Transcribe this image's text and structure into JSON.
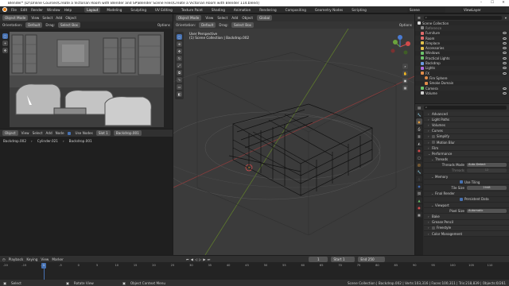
{
  "window": {
    "title": "Blender* [D:\\Online Courses\\Create a Victorian Room with Blender and SP\\Blender Scene Files\\Create a Victorian Room with Blender 114.blend]",
    "controls": [
      "–",
      "☐",
      "✕"
    ]
  },
  "menu": {
    "items": [
      "File",
      "Edit",
      "Render",
      "Window",
      "Help"
    ],
    "workspaces": [
      "Layout",
      "Modeling",
      "Sculpting",
      "UV Editing",
      "Texture Paint",
      "Shading",
      "Animation",
      "Rendering",
      "Compositing",
      "Geometry Nodes",
      "Scripting"
    ],
    "active_workspace": "Layout",
    "scene_label": "Scene",
    "view_layer_label": "ViewLayer"
  },
  "render_view": {
    "mode": "Object Mode",
    "menus": [
      "View",
      "Select",
      "Add",
      "Object"
    ],
    "orientation_label": "Orientation:",
    "orientation_value": "Default",
    "drag_label": "Drag:",
    "drag_value": "Select Box",
    "options_label": "Options"
  },
  "viewport": {
    "mode": "Object Mode",
    "menus": [
      "View",
      "Select",
      "Add",
      "Object"
    ],
    "transform": "Global",
    "orientation_label": "Orientation:",
    "orientation_value": "Default",
    "drag_label": "Drag:",
    "drag_value": "Select Box",
    "options_label": "Options",
    "info_line1": "User Perspective",
    "info_line2": "(1) Scene Collection | Backdrop.002",
    "gizmo_labels": [
      "X",
      "Y",
      "Z"
    ]
  },
  "node_editor": {
    "editor": "Object",
    "menus": [
      "View",
      "Select",
      "Add",
      "Node"
    ],
    "use_nodes_label": "Use Nodes",
    "slot": "Slot 1",
    "material": "Backdrop.001",
    "breadcrumb": [
      "Backdrop.002",
      "Cylinder.021",
      "Backdrop.001"
    ]
  },
  "outliner": {
    "header": "Scene Collection",
    "search_placeholder": "",
    "items": [
      {
        "name": "Scene Collection",
        "color": "#dddddd"
      },
      {
        "name": "Reference",
        "color": "#888888"
      },
      {
        "name": "Furniture",
        "color": "#e06b6b"
      },
      {
        "name": "Room",
        "color": "#e06b6b"
      },
      {
        "name": "Fireplace",
        "color": "#e0c04b"
      },
      {
        "name": "Accessories",
        "color": "#e0c04b"
      },
      {
        "name": "Windows",
        "color": "#6bc36b"
      },
      {
        "name": "Practical Lights",
        "color": "#6bc36b"
      },
      {
        "name": "Backdrop",
        "color": "#6b9ae0"
      },
      {
        "name": "Lights",
        "color": "#b06be0"
      },
      {
        "name": "FX",
        "color": "#e08c4b"
      },
      {
        "name": "Fire Sphere",
        "color": "#e08c4b"
      },
      {
        "name": "Smoke Domain",
        "color": "#e08c4b"
      },
      {
        "name": "Camera",
        "color": "#cfcfcf"
      },
      {
        "name": "Volume",
        "color": "#cfcfcf"
      }
    ]
  },
  "properties": {
    "panels": [
      {
        "label": "Advanced",
        "open": false
      },
      {
        "label": "Light Paths",
        "open": false
      },
      {
        "label": "Volumes",
        "open": false
      },
      {
        "label": "Curves",
        "open": false
      },
      {
        "label": "Simplify",
        "open": false
      },
      {
        "label": "Motion Blur",
        "open": false
      },
      {
        "label": "Film",
        "open": false
      },
      {
        "label": "Performance",
        "open": true
      }
    ],
    "threads_label": "Threads",
    "threads_mode_label": "Threads Mode",
    "threads_mode_value": "Auto-Detect",
    "threads_count_label": "Threads",
    "threads_count_value": "12",
    "memory_label": "Memory",
    "use_tiling_label": "Use Tiling",
    "tile_size_label": "Tile Size",
    "tile_size_value": "2048",
    "final_render_label": "Final Render",
    "persistent_data_label": "Persistent Data",
    "viewport_label": "Viewport",
    "pixel_size_label": "Pixel Size",
    "pixel_size_value": "Automatic",
    "bottom_panels": [
      "Bake",
      "Grease Pencil",
      "Freestyle",
      "Color Management"
    ]
  },
  "timeline": {
    "menus": [
      "Playback",
      "Keying",
      "View",
      "Marker"
    ],
    "current_frame": "1",
    "start_label": "Start",
    "start_value": "1",
    "end_label": "End",
    "end_value": "250",
    "ticks": [
      "-20",
      "-15",
      "-10",
      "-5",
      "0",
      "5",
      "10",
      "15",
      "20",
      "25",
      "30",
      "35",
      "40",
      "45",
      "50",
      "55",
      "60",
      "65",
      "70",
      "75",
      "80",
      "85",
      "90",
      "95",
      "100",
      "105",
      "110"
    ]
  },
  "statusbar": {
    "select": "Select",
    "rotate": "Rotate View",
    "context": "Object Context Menu",
    "stats": "Scene Collection | Backdrop.002 | Verts:103,316 | Faces:100,311 | Tris:218,839 | Objects:0/261"
  }
}
